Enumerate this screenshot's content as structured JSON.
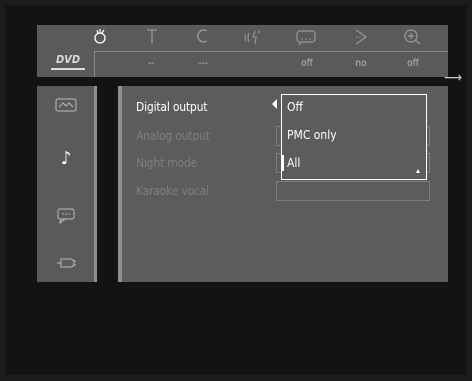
{
  "topbar": {
    "icons": [
      "bulb-icon",
      "title-icon",
      "chapter-icon",
      "audio-icon",
      "subtitle-icon",
      "angle-icon",
      "zoom-icon"
    ],
    "disc_logo": "DVD",
    "values": [
      "--",
      "---",
      "off",
      "no",
      "off"
    ]
  },
  "sidebar": {
    "icons": [
      "picture-icon",
      "music-note-icon",
      "speech-bubble-icon",
      "plug-icon"
    ],
    "active_index": 1
  },
  "panel": {
    "rows": [
      {
        "label": "Digital output",
        "active": true
      },
      {
        "label": "Analog output",
        "active": false
      },
      {
        "label": "Night mode",
        "active": false
      },
      {
        "label": "Karaoke vocal",
        "active": false
      }
    ]
  },
  "dropdown": {
    "options": [
      "Off",
      "PMC only",
      "All"
    ],
    "highlighted_index": 2
  },
  "colors": {
    "panel": "#5c5c5c",
    "background": "#131313",
    "highlight": "#ffffff",
    "inactive_text": "#7f7f7f"
  }
}
